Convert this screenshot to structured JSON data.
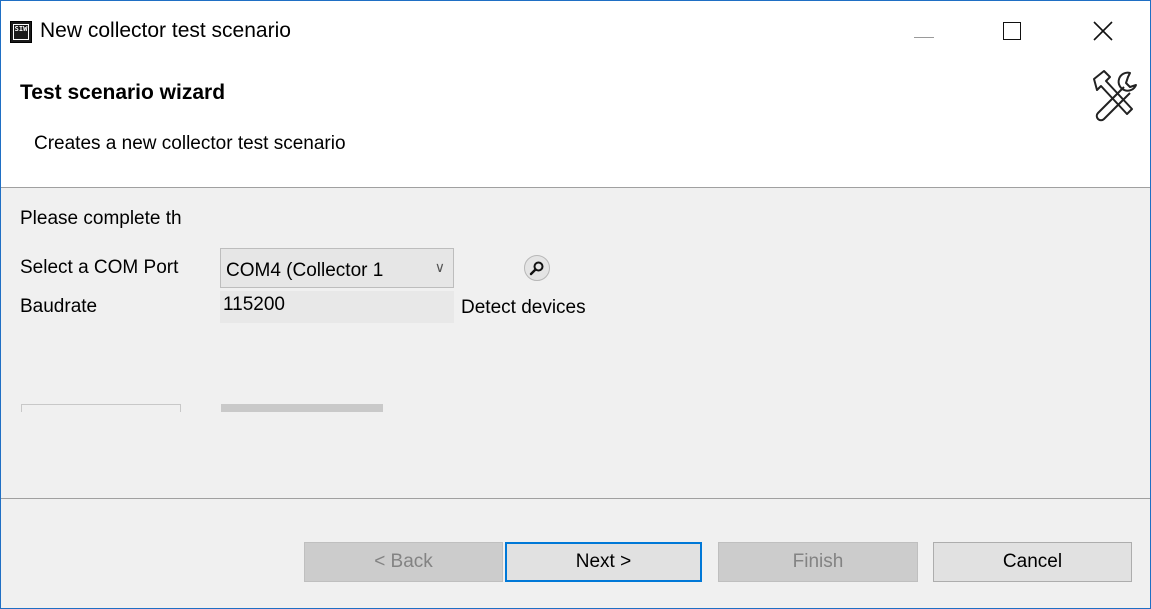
{
  "window": {
    "title": "New collector test scenario",
    "app_icon_text": "SIW",
    "border_color": "#1f6fc4"
  },
  "header": {
    "title": "Test scenario wizard",
    "description": "Creates a new collector test scenario",
    "icon": "tools-icon"
  },
  "form": {
    "message": "Please complete th",
    "com_port_label": "Select a COM Port",
    "com_port_value": "COM4 (Collector 1",
    "baudrate_label": "Baudrate",
    "baudrate_value": "115200",
    "detect_label": "Detect devices"
  },
  "buttons": {
    "back": "< Back",
    "next": "Next >",
    "finish": "Finish",
    "cancel": "Cancel"
  },
  "colors": {
    "accent": "#0078d7",
    "dialog_bg": "#f0f0f0",
    "disabled_text": "#838383"
  }
}
